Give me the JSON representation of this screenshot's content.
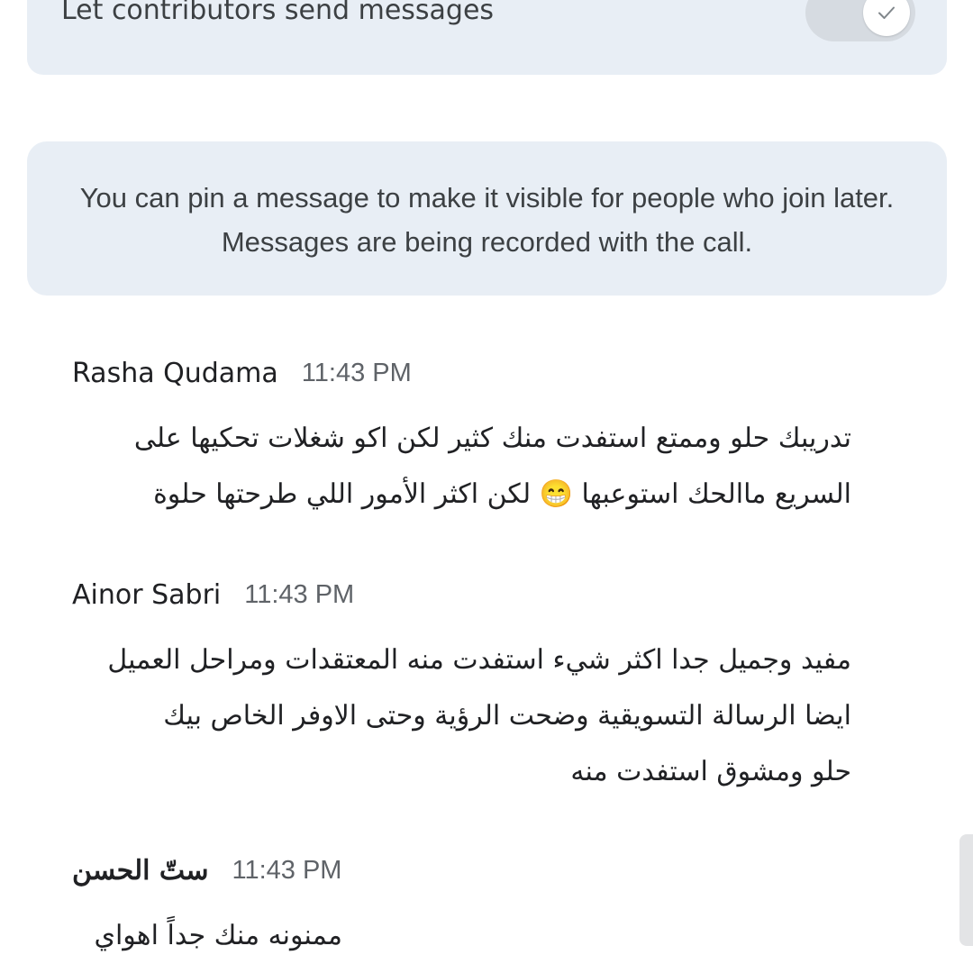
{
  "settings": {
    "contributors_toggle_label": "Let contributors send messages",
    "contributors_toggle_on": false
  },
  "info": {
    "text": "You can pin a message to make it visible for people who join later. Messages are being recorded with the call."
  },
  "messages": [
    {
      "sender": "Rasha Qudama",
      "time": "11:43 PM",
      "lines": [
        "تدريبك حلو وممتع استفدت منك كثير لكن اكو شغلات تحكيها على",
        "السريع ماالحك استوعبها 😁 لكن اكثر الأمور اللي طرحتها حلوة"
      ]
    },
    {
      "sender": "Ainor Sabri",
      "time": "11:43 PM",
      "lines": [
        "مفيد وجميل جدا اكثر شيء استفدت منه المعتقدات ومراحل العميل",
        "ايضا الرسالة التسويقية وضحت الرؤية وحتى الاوفر الخاص بيك",
        "حلو ومشوق استفدت منه"
      ]
    },
    {
      "sender": "ستّ الحسن",
      "time": "11:43 PM",
      "lines": [
        "ممنونه منك جداً اهواي"
      ]
    }
  ],
  "icons": {
    "toggle_knob": "check-icon"
  },
  "colors": {
    "card_background": "#e8eef5",
    "primary_text": "#202124",
    "secondary_text": "#5f6368",
    "switch_track": "#d6dbe1"
  }
}
